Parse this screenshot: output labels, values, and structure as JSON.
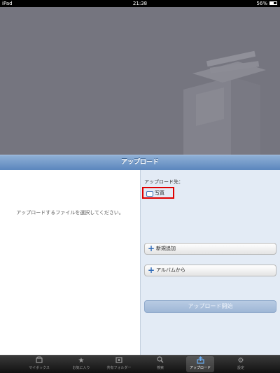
{
  "status_bar": {
    "carrier": "iPad",
    "time": "21:38",
    "battery": "56%"
  },
  "title": "アップロード",
  "left_pane": {
    "instruction": "アップロードするファイルを選択してください。"
  },
  "right_pane": {
    "destination_label": "アップロード先：",
    "destination_folder": "写真",
    "add_new_label": "新規追加",
    "from_album_label": "アルバムから",
    "start_upload_label": "アップロード開始"
  },
  "tabs": [
    {
      "label": "マイボックス",
      "icon": "box-icon"
    },
    {
      "label": "お気に入り",
      "icon": "star-icon"
    },
    {
      "label": "共有フォルダー",
      "icon": "shared-folder-icon"
    },
    {
      "label": "検索",
      "icon": "search-icon"
    },
    {
      "label": "アップロード",
      "icon": "upload-icon",
      "selected": true
    },
    {
      "label": "設定",
      "icon": "gear-icon"
    }
  ],
  "colors": {
    "title_bar": "#5b86bd",
    "selected_tab_icon": "#6aaef5",
    "highlight": "#e00000"
  }
}
